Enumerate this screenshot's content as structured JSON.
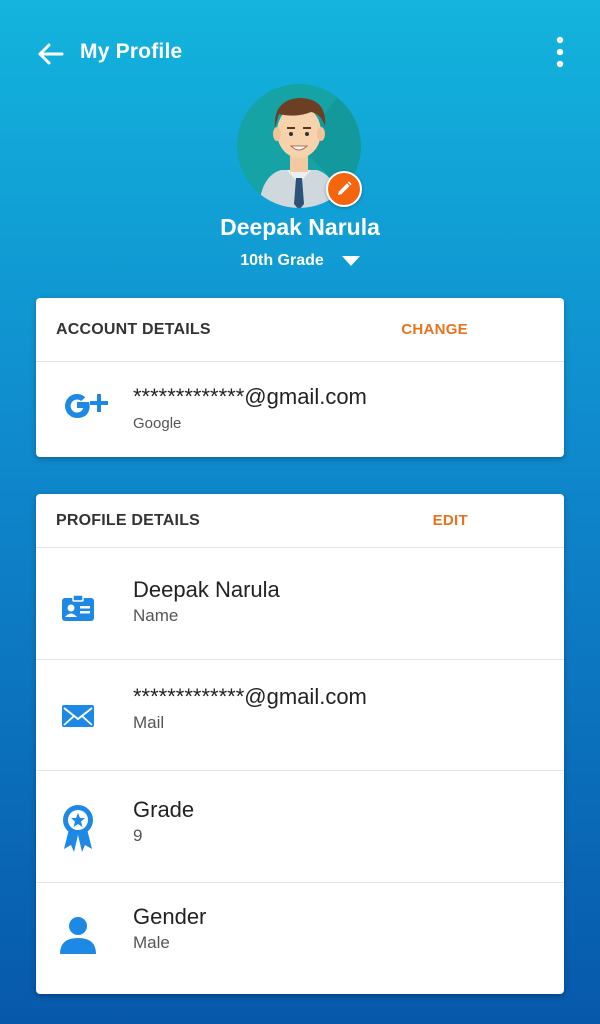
{
  "header": {
    "title": "My Profile"
  },
  "profile": {
    "name": "Deepak Narula",
    "grade": "10th Grade"
  },
  "account": {
    "header": "ACCOUNT DETAILS",
    "action": "CHANGE",
    "email": "*************@gmail.com",
    "provider": "Google",
    "provider_icon": "google-plus-icon"
  },
  "details": {
    "header": "PROFILE DETAILS",
    "action": "EDIT",
    "rows": [
      {
        "value": "Deepak Narula",
        "label": "Name",
        "icon": "id-card-icon"
      },
      {
        "value": "*************@gmail.com",
        "label": "Mail",
        "icon": "mail-icon"
      },
      {
        "value": "Grade",
        "label": "9",
        "icon": "award-badge-icon"
      },
      {
        "value": "Gender",
        "label": "Male",
        "icon": "person-icon"
      }
    ]
  },
  "colors": {
    "accent": "#e8731e",
    "icon_blue": "#1e88e5",
    "gradient_top": "#13b4dd",
    "gradient_bottom": "#0758ab"
  }
}
